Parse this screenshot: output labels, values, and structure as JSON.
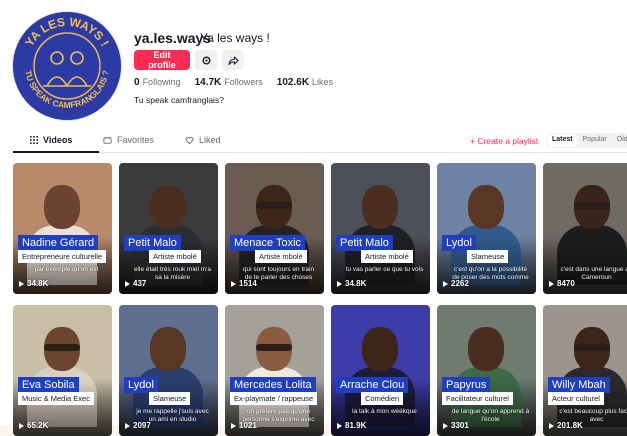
{
  "profile": {
    "username": "ya.les.ways",
    "nickname": "Ya les ways !",
    "edit_label": "Edit profile",
    "settings_icon": "gear-icon",
    "share_icon": "share-icon",
    "bio": "Tu speak camfranglais?",
    "avatar_text_top": "YA LES WAYS !",
    "avatar_text_bottom": "TU SPEAK CAMFRANGLAIS ?"
  },
  "stats": [
    {
      "value": "0",
      "label": "Following"
    },
    {
      "value": "14.7K",
      "label": "Followers"
    },
    {
      "value": "102.6K",
      "label": "Likes"
    }
  ],
  "tabs": [
    {
      "label": "Videos",
      "icon": "grid-icon"
    },
    {
      "label": "Favorites",
      "icon": "bookmark-icon"
    },
    {
      "label": "Liked",
      "icon": "heart-icon"
    }
  ],
  "create_playlist": "+ Create a playlist",
  "sort": [
    "Latest",
    "Popular",
    "Oldest"
  ],
  "videos": [
    {
      "name": "Nadine Gérard",
      "role": "Entrepreneure culturelle",
      "caption": "par exemple qu'on est",
      "views": "34.8K",
      "bg": "#b88a6a",
      "skin": "#6b4330",
      "shirt": "#e9e1d6",
      "glasses": false
    },
    {
      "name": "Petit Malo",
      "role": "Artiste mbolé",
      "caption": "elle était très rouk miel m'a sa la misère",
      "views": "437",
      "bg": "#3c3a3d",
      "skin": "#4a2e20",
      "shirt": "#2c2d31",
      "glasses": false
    },
    {
      "name": "Menace Toxic",
      "role": "Artiste mbolé",
      "caption": "qui sont toujours en train de te parler des choses",
      "views": "1514",
      "bg": "#6a5c52",
      "skin": "#3d2619",
      "shirt": "#232325",
      "glasses": true
    },
    {
      "name": "Petit Malo",
      "role": "Artiste mbolé",
      "caption": "tu vas parler ce que tu vois",
      "views": "34.8K",
      "bg": "#4d5058",
      "skin": "#4a2e20",
      "shirt": "#1f2024",
      "glasses": false
    },
    {
      "name": "Lydol",
      "role": "Slameuse",
      "caption": "c'est qu'on a la possibilité de poser des mots comme",
      "views": "2262",
      "bg": "#6e83a3",
      "skin": "#5a3624",
      "shirt": "#315a8a",
      "glasses": false
    },
    {
      "name": "",
      "role": "",
      "caption": "c'est dans une langue au Cameroun",
      "views": "8470",
      "bg": "#6e6a64",
      "skin": "#3a2419",
      "shirt": "#1d1d1f",
      "glasses": true
    },
    {
      "name": "Eva Sobila",
      "role": "Music & Media Exec",
      "caption": "",
      "views": "65.2K",
      "bg": "#c9bfa6",
      "skin": "#6d452f",
      "shirt": "#d9d0c1",
      "glasses": true
    },
    {
      "name": "Lydol",
      "role": "Slameuse",
      "caption": "je me rappelle j'suis avec un ami en studio",
      "views": "2097",
      "bg": "#5f6f8f",
      "skin": "#5a3624",
      "shirt": "#2b3e6d",
      "glasses": false
    },
    {
      "name": "Mercedes Lolita",
      "role": "Ex-playmate / rappeuse",
      "caption": "on préfère pas qu'une personne s'exprime avec",
      "views": "1021",
      "bg": "#a4a09a",
      "skin": "#8a5c40",
      "shirt": "#f0e9e0",
      "glasses": true
    },
    {
      "name": "Arrache Clou",
      "role": "Comédien",
      "caption": "la talk à mon wéékque",
      "views": "81.9K",
      "bg": "#3e3ca8",
      "skin": "#3d2518",
      "shirt": "#1c1b3a",
      "glasses": false
    },
    {
      "name": "Papyrus",
      "role": "Facilitateur culturel",
      "caption": "de langue qu'on apprend à l'école",
      "views": "3301",
      "bg": "#6f7b70",
      "skin": "#4a2d1e",
      "shirt": "#3c6b46",
      "glasses": false
    },
    {
      "name": "Willy Mbah",
      "role": "Acteur culturel",
      "caption": "c'est beaucoup plus facile avec",
      "views": "201.8K",
      "bg": "#9c958c",
      "skin": "#3b2418",
      "shirt": "#2a2a2c",
      "glasses": true
    }
  ]
}
